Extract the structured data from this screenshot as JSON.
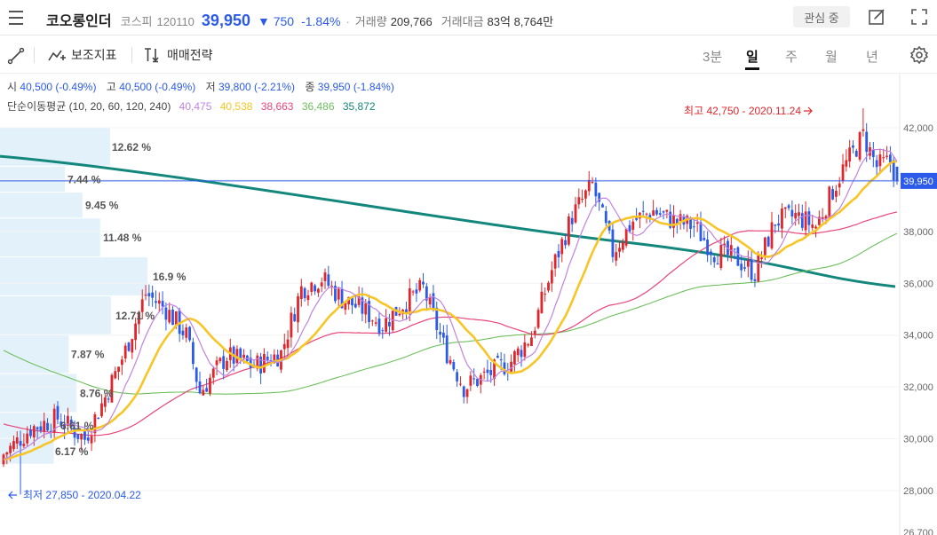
{
  "header": {
    "name": "코오롱인더",
    "market": "코스피",
    "code": "120110",
    "price": "39,950",
    "change_arrow": "▼",
    "change": "750",
    "change_rate": "-1.84%",
    "separator": "·",
    "volume_label": "거래량",
    "volume": "209,766",
    "turnover_label": "거래대금",
    "turnover": "83억 8,764만",
    "watch_label": "관심 중",
    "icons": [
      "menu-icon",
      "edit-icon",
      "fullscreen-icon"
    ]
  },
  "toolbar": {
    "indicator_label": "보조지표",
    "strategy_label": "매매전략",
    "periods": [
      "3분",
      "일",
      "주",
      "월",
      "년"
    ],
    "active_period": "일",
    "icons": [
      "draw-line-icon",
      "indicator-icon",
      "strategy-icon",
      "settings-icon"
    ]
  },
  "ohlc": {
    "open_label": "시",
    "open": "40,500 (-0.49%)",
    "high_label": "고",
    "high": "40,500 (-0.49%)",
    "low_label": "저",
    "low": "39,800 (-2.21%)",
    "close_label": "종",
    "close": "39,950 (-1.84%)"
  },
  "ma": {
    "label": "단순이동평균 (10, 20, 60, 120, 240)",
    "values": [
      "40,475",
      "40,538",
      "38,663",
      "36,486",
      "35,872"
    ],
    "colors": [
      "#c084e0",
      "#f7c525",
      "#e8457a",
      "#6fbf5e",
      "#14877c"
    ]
  },
  "chart_data": {
    "type": "candlestick",
    "y_ticks": [
      "42,000",
      "40,000",
      "38,000",
      "36,000",
      "34,000",
      "32,000",
      "30,000",
      "28,000",
      "26,700"
    ],
    "current_price_label": "39,950",
    "current_price": 39950,
    "ylim": [
      26700,
      43000
    ],
    "high_annotation": "최고 42,750 - 2020.11.24",
    "low_annotation": "최저 27,850 - 2020.04.22",
    "volume_profile": {
      "labels": [
        "12.62 %",
        "7.44 %",
        "9.45 %",
        "11.48 %",
        "16.9 %",
        "12.71 %",
        "7.87 %",
        "8.76 %",
        "6.61 %",
        "6.17 %"
      ],
      "values": [
        12.62,
        7.44,
        9.45,
        11.48,
        16.9,
        12.71,
        7.87,
        8.76,
        6.61,
        6.17
      ],
      "price_bins": [
        [
          40500,
          42000
        ],
        [
          39500,
          40500
        ],
        [
          38500,
          39500
        ],
        [
          37000,
          38500
        ],
        [
          35500,
          37000
        ],
        [
          34000,
          35500
        ],
        [
          32500,
          34000
        ],
        [
          31000,
          32500
        ],
        [
          30000,
          31000
        ],
        [
          29000,
          30000
        ]
      ]
    },
    "colors": {
      "up": "#e0262a",
      "down": "#2b5be8",
      "price_line": "#2b5be8",
      "profile": "#e3f1fb"
    }
  }
}
